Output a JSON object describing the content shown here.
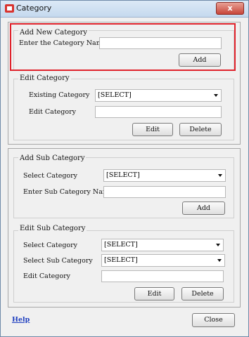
{
  "window": {
    "title": "Category",
    "close_glyph": "x"
  },
  "add_category": {
    "legend": "Add New Category",
    "name_label": "Enter the Category Name",
    "name_value": "",
    "add_label": "Add"
  },
  "edit_category": {
    "legend": "Edit Category",
    "existing_label": "Existing Category",
    "existing_value": "[SELECT]",
    "edit_label": "Edit Category",
    "edit_value": "",
    "edit_button": "Edit",
    "delete_button": "Delete"
  },
  "add_sub": {
    "legend": "Add Sub Category",
    "select_label": "Select Category",
    "select_value": "[SELECT]",
    "name_label": "Enter Sub Category Name",
    "name_value": "",
    "add_label": "Add"
  },
  "edit_sub": {
    "legend": "Edit Sub Category",
    "select_label": "Select Category",
    "select_value": "[SELECT]",
    "sub_label": "Select Sub Category",
    "sub_value": "[SELECT]",
    "edit_label": "Edit Category",
    "edit_value": "",
    "edit_button": "Edit",
    "delete_button": "Delete"
  },
  "footer": {
    "help": "Help",
    "close": "Close"
  },
  "colors": {
    "highlight": "#e0222b",
    "link": "#1f3fbf"
  }
}
